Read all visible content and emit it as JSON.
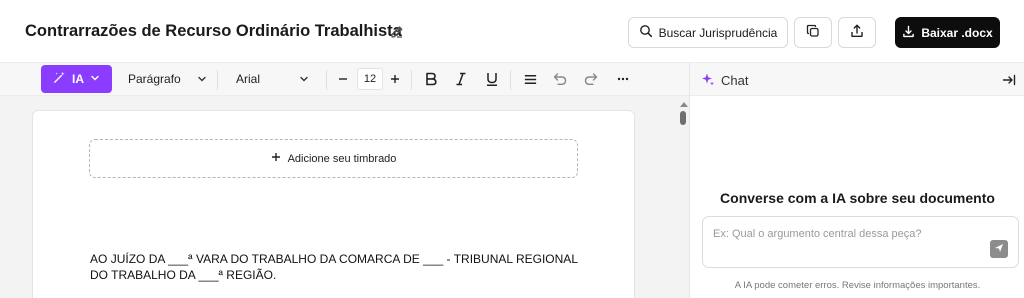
{
  "header": {
    "title": "Contrarrazões de Recurso Ordinário Trabalhista",
    "search_label": "Buscar Jurisprudência",
    "download_label": "Baixar .docx"
  },
  "toolbar": {
    "ia_label": "IA",
    "paragraph_style": "Parágrafo",
    "font_family": "Arial",
    "font_size": "12"
  },
  "chat": {
    "title": "Chat",
    "heading": "Converse com a IA sobre seu documento",
    "input_placeholder": "Ex: Qual o argumento central dessa peça?",
    "disclaimer": "A IA pode cometer erros. Revise informações importantes."
  },
  "document": {
    "letterhead_label": "Adicione seu timbrado",
    "body": "AO JUÍZO DA ___ª VARA DO TRABALHO DA COMARCA DE ___ - TRIBUNAL REGIONAL DO TRABALHO DA ___ª REGIÃO."
  },
  "icons": {
    "edit": "pencil-icon",
    "search": "search-icon",
    "copy": "copy-icon",
    "share": "share-icon",
    "download": "download-icon",
    "ia": "magic-wand-icon",
    "bold": "bold-icon",
    "italic": "italic-icon",
    "underline": "underline-icon",
    "align": "align-icon",
    "undo": "undo-icon",
    "redo": "redo-icon",
    "more": "more-icon",
    "sparkle": "sparkle-icon",
    "collapse": "collapse-panel-icon",
    "send": "send-icon"
  },
  "colors": {
    "accent": "#8b3dff",
    "download_bg": "#0d0d0d"
  }
}
